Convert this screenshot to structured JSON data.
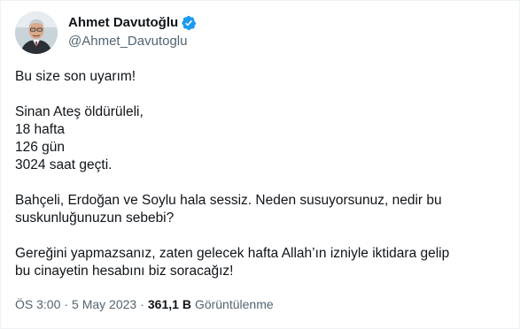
{
  "author": {
    "display_name": "Ahmet Davutoğlu",
    "handle": "@Ahmet_Davutoglu",
    "verified": true,
    "verified_color": "#1d9bf0",
    "avatar_icon": "profile-photo"
  },
  "tweet": {
    "paragraphs": [
      [
        "Bu size son uyarım!"
      ],
      [
        "Sinan Ateş öldürüleli,",
        "18 hafta",
        "126 gün",
        "3024 saat geçti."
      ],
      [
        "Bahçeli, Erdoğan ve Soylu hala sessiz. Neden susuyorsunuz, nedir bu",
        "suskunluğunuzun sebebi?"
      ],
      [
        "Gereğini yapmazsanız, zaten gelecek hafta Allah’ın izniyle iktidara gelip",
        "bu cinayetin hesabını biz soracağız!"
      ]
    ]
  },
  "meta": {
    "time": "ÖS 3:00",
    "separator": "·",
    "date": "5 May 2023",
    "views_count": "361,1 B",
    "views_label": "Görüntülenme"
  }
}
